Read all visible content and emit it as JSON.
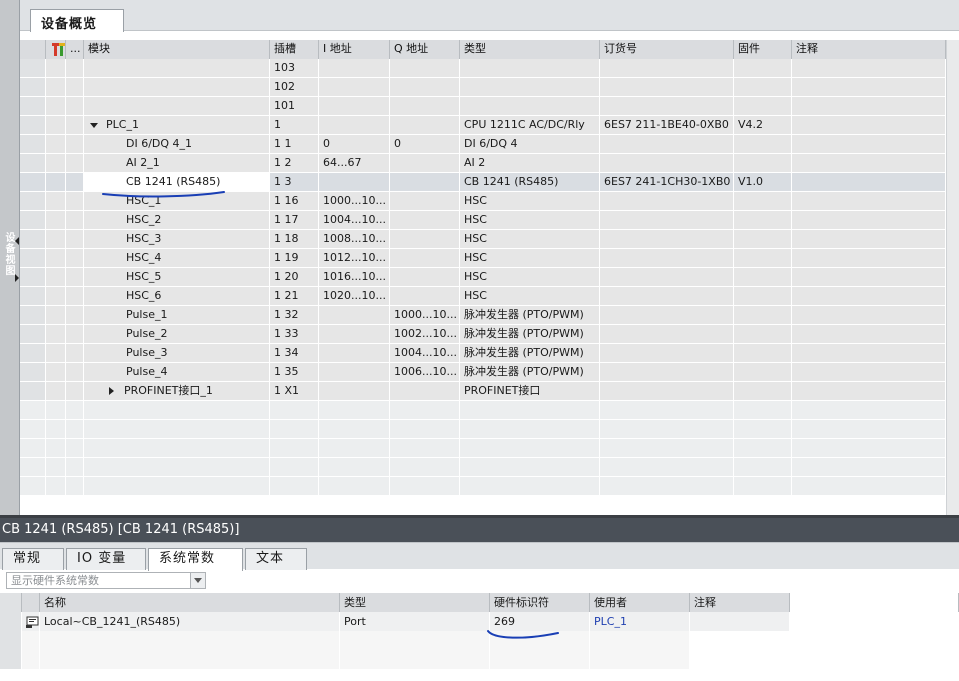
{
  "side_panel": {
    "label": "设备视图"
  },
  "overview_tab": {
    "label": "设备概览"
  },
  "table": {
    "headers": {
      "name": "模块",
      "dots": "...",
      "slot": "插槽",
      "i_addr": "I 地址",
      "q_addr": "Q 地址",
      "type": "类型",
      "order": "订货号",
      "firmware": "固件",
      "comment": "注释"
    },
    "rows": [
      {
        "name": "",
        "slot": "103",
        "i_addr": "",
        "q_addr": "",
        "type": "",
        "order": "",
        "firmware": ""
      },
      {
        "name": "",
        "slot": "102",
        "i_addr": "",
        "q_addr": "",
        "type": "",
        "order": "",
        "firmware": ""
      },
      {
        "name": "",
        "slot": "101",
        "i_addr": "",
        "q_addr": "",
        "type": "",
        "order": "",
        "firmware": ""
      },
      {
        "name": "PLC_1",
        "slot": "1",
        "i_addr": "",
        "q_addr": "",
        "type": "CPU 1211C AC/DC/Rly",
        "order": "6ES7 211-1BE40-0XB0",
        "firmware": "V4.2"
      },
      {
        "name": "DI 6/DQ 4_1",
        "slot": "1 1",
        "i_addr": "0",
        "q_addr": "0",
        "type": "DI 6/DQ 4",
        "order": "",
        "firmware": ""
      },
      {
        "name": "AI 2_1",
        "slot": "1 2",
        "i_addr": "64...67",
        "q_addr": "",
        "type": "AI 2",
        "order": "",
        "firmware": ""
      },
      {
        "name": "CB 1241 (RS485)",
        "slot": "1 3",
        "i_addr": "",
        "q_addr": "",
        "type": "CB 1241 (RS485)",
        "order": "6ES7 241-1CH30-1XB0",
        "firmware": "V1.0"
      },
      {
        "name": "HSC_1",
        "slot": "1 16",
        "i_addr": "1000...10...",
        "q_addr": "",
        "type": "HSC",
        "order": "",
        "firmware": ""
      },
      {
        "name": "HSC_2",
        "slot": "1 17",
        "i_addr": "1004...10...",
        "q_addr": "",
        "type": "HSC",
        "order": "",
        "firmware": ""
      },
      {
        "name": "HSC_3",
        "slot": "1 18",
        "i_addr": "1008...10...",
        "q_addr": "",
        "type": "HSC",
        "order": "",
        "firmware": ""
      },
      {
        "name": "HSC_4",
        "slot": "1 19",
        "i_addr": "1012...10...",
        "q_addr": "",
        "type": "HSC",
        "order": "",
        "firmware": ""
      },
      {
        "name": "HSC_5",
        "slot": "1 20",
        "i_addr": "1016...10...",
        "q_addr": "",
        "type": "HSC",
        "order": "",
        "firmware": ""
      },
      {
        "name": "HSC_6",
        "slot": "1 21",
        "i_addr": "1020...10...",
        "q_addr": "",
        "type": "HSC",
        "order": "",
        "firmware": ""
      },
      {
        "name": "Pulse_1",
        "slot": "1 32",
        "i_addr": "",
        "q_addr": "1000...10...",
        "type": "脉冲发生器 (PTO/PWM)",
        "order": "",
        "firmware": ""
      },
      {
        "name": "Pulse_2",
        "slot": "1 33",
        "i_addr": "",
        "q_addr": "1002...10...",
        "type": "脉冲发生器 (PTO/PWM)",
        "order": "",
        "firmware": ""
      },
      {
        "name": "Pulse_3",
        "slot": "1 34",
        "i_addr": "",
        "q_addr": "1004...10...",
        "type": "脉冲发生器 (PTO/PWM)",
        "order": "",
        "firmware": ""
      },
      {
        "name": "Pulse_4",
        "slot": "1 35",
        "i_addr": "",
        "q_addr": "1006...10...",
        "type": "脉冲发生器 (PTO/PWM)",
        "order": "",
        "firmware": ""
      },
      {
        "name": "PROFINET接口_1",
        "slot": "1 X1",
        "i_addr": "",
        "q_addr": "",
        "type": "PROFINET接口",
        "order": "",
        "firmware": ""
      }
    ]
  },
  "inspector": {
    "title": "CB 1241 (RS485) [CB 1241 (RS485)]",
    "tabs": [
      "常规",
      "IO 变量",
      "系统常数",
      "文本"
    ],
    "active_tab": "系统常数",
    "filter_placeholder": "显示硬件系统常数",
    "headers": {
      "name": "名称",
      "type": "类型",
      "hwid": "硬件标识符",
      "user": "使用者",
      "comment": "注释"
    },
    "rows": [
      {
        "name": "Local~CB_1241_(RS485)",
        "type": "Port",
        "hwid": "269",
        "user": "PLC_1",
        "comment": ""
      }
    ]
  },
  "colors": {
    "accent_blue": "#1f3fb0",
    "info_bar": "#4a5058",
    "pen": "#1a3fb5"
  }
}
